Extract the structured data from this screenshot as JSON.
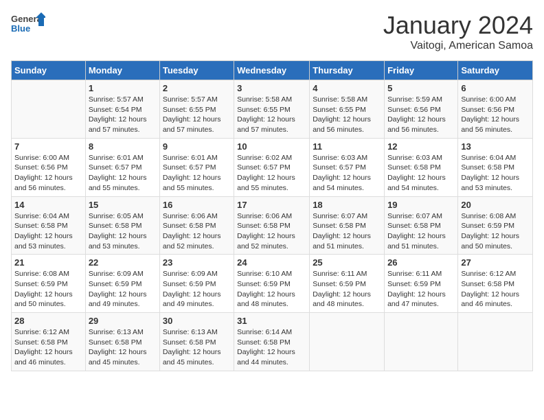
{
  "header": {
    "logo_general": "General",
    "logo_blue": "Blue",
    "title": "January 2024",
    "subtitle": "Vaitogi, American Samoa"
  },
  "calendar": {
    "days_of_week": [
      "Sunday",
      "Monday",
      "Tuesday",
      "Wednesday",
      "Thursday",
      "Friday",
      "Saturday"
    ],
    "weeks": [
      [
        {
          "num": "",
          "info": ""
        },
        {
          "num": "1",
          "info": "Sunrise: 5:57 AM\nSunset: 6:54 PM\nDaylight: 12 hours\nand 57 minutes."
        },
        {
          "num": "2",
          "info": "Sunrise: 5:57 AM\nSunset: 6:55 PM\nDaylight: 12 hours\nand 57 minutes."
        },
        {
          "num": "3",
          "info": "Sunrise: 5:58 AM\nSunset: 6:55 PM\nDaylight: 12 hours\nand 57 minutes."
        },
        {
          "num": "4",
          "info": "Sunrise: 5:58 AM\nSunset: 6:55 PM\nDaylight: 12 hours\nand 56 minutes."
        },
        {
          "num": "5",
          "info": "Sunrise: 5:59 AM\nSunset: 6:56 PM\nDaylight: 12 hours\nand 56 minutes."
        },
        {
          "num": "6",
          "info": "Sunrise: 6:00 AM\nSunset: 6:56 PM\nDaylight: 12 hours\nand 56 minutes."
        }
      ],
      [
        {
          "num": "7",
          "info": "Sunrise: 6:00 AM\nSunset: 6:56 PM\nDaylight: 12 hours\nand 56 minutes."
        },
        {
          "num": "8",
          "info": "Sunrise: 6:01 AM\nSunset: 6:57 PM\nDaylight: 12 hours\nand 55 minutes."
        },
        {
          "num": "9",
          "info": "Sunrise: 6:01 AM\nSunset: 6:57 PM\nDaylight: 12 hours\nand 55 minutes."
        },
        {
          "num": "10",
          "info": "Sunrise: 6:02 AM\nSunset: 6:57 PM\nDaylight: 12 hours\nand 55 minutes."
        },
        {
          "num": "11",
          "info": "Sunrise: 6:03 AM\nSunset: 6:57 PM\nDaylight: 12 hours\nand 54 minutes."
        },
        {
          "num": "12",
          "info": "Sunrise: 6:03 AM\nSunset: 6:58 PM\nDaylight: 12 hours\nand 54 minutes."
        },
        {
          "num": "13",
          "info": "Sunrise: 6:04 AM\nSunset: 6:58 PM\nDaylight: 12 hours\nand 53 minutes."
        }
      ],
      [
        {
          "num": "14",
          "info": "Sunrise: 6:04 AM\nSunset: 6:58 PM\nDaylight: 12 hours\nand 53 minutes."
        },
        {
          "num": "15",
          "info": "Sunrise: 6:05 AM\nSunset: 6:58 PM\nDaylight: 12 hours\nand 53 minutes."
        },
        {
          "num": "16",
          "info": "Sunrise: 6:06 AM\nSunset: 6:58 PM\nDaylight: 12 hours\nand 52 minutes."
        },
        {
          "num": "17",
          "info": "Sunrise: 6:06 AM\nSunset: 6:58 PM\nDaylight: 12 hours\nand 52 minutes."
        },
        {
          "num": "18",
          "info": "Sunrise: 6:07 AM\nSunset: 6:58 PM\nDaylight: 12 hours\nand 51 minutes."
        },
        {
          "num": "19",
          "info": "Sunrise: 6:07 AM\nSunset: 6:58 PM\nDaylight: 12 hours\nand 51 minutes."
        },
        {
          "num": "20",
          "info": "Sunrise: 6:08 AM\nSunset: 6:59 PM\nDaylight: 12 hours\nand 50 minutes."
        }
      ],
      [
        {
          "num": "21",
          "info": "Sunrise: 6:08 AM\nSunset: 6:59 PM\nDaylight: 12 hours\nand 50 minutes."
        },
        {
          "num": "22",
          "info": "Sunrise: 6:09 AM\nSunset: 6:59 PM\nDaylight: 12 hours\nand 49 minutes."
        },
        {
          "num": "23",
          "info": "Sunrise: 6:09 AM\nSunset: 6:59 PM\nDaylight: 12 hours\nand 49 minutes."
        },
        {
          "num": "24",
          "info": "Sunrise: 6:10 AM\nSunset: 6:59 PM\nDaylight: 12 hours\nand 48 minutes."
        },
        {
          "num": "25",
          "info": "Sunrise: 6:11 AM\nSunset: 6:59 PM\nDaylight: 12 hours\nand 48 minutes."
        },
        {
          "num": "26",
          "info": "Sunrise: 6:11 AM\nSunset: 6:59 PM\nDaylight: 12 hours\nand 47 minutes."
        },
        {
          "num": "27",
          "info": "Sunrise: 6:12 AM\nSunset: 6:58 PM\nDaylight: 12 hours\nand 46 minutes."
        }
      ],
      [
        {
          "num": "28",
          "info": "Sunrise: 6:12 AM\nSunset: 6:58 PM\nDaylight: 12 hours\nand 46 minutes."
        },
        {
          "num": "29",
          "info": "Sunrise: 6:13 AM\nSunset: 6:58 PM\nDaylight: 12 hours\nand 45 minutes."
        },
        {
          "num": "30",
          "info": "Sunrise: 6:13 AM\nSunset: 6:58 PM\nDaylight: 12 hours\nand 45 minutes."
        },
        {
          "num": "31",
          "info": "Sunrise: 6:14 AM\nSunset: 6:58 PM\nDaylight: 12 hours\nand 44 minutes."
        },
        {
          "num": "",
          "info": ""
        },
        {
          "num": "",
          "info": ""
        },
        {
          "num": "",
          "info": ""
        }
      ]
    ]
  }
}
